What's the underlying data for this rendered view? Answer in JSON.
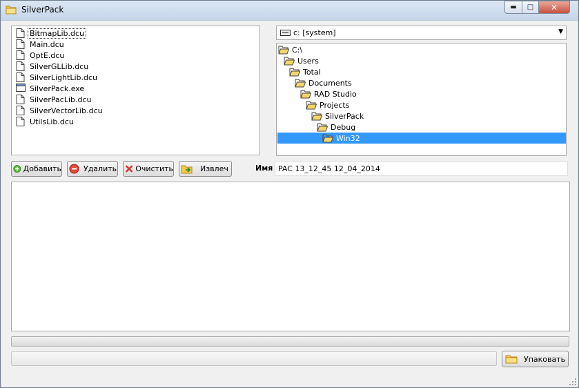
{
  "window": {
    "title": "SilverPack"
  },
  "files": [
    {
      "name": "BitmapLib.dcu",
      "icon": "document-icon",
      "selected": true
    },
    {
      "name": "Main.dcu",
      "icon": "document-icon"
    },
    {
      "name": "OptE.dcu",
      "icon": "document-icon"
    },
    {
      "name": "SilverGLLib.dcu",
      "icon": "document-icon"
    },
    {
      "name": "SilverLightLib.dcu",
      "icon": "document-icon"
    },
    {
      "name": "SilverPack.exe",
      "icon": "application-icon"
    },
    {
      "name": "SilverPacLib.dcu",
      "icon": "document-icon"
    },
    {
      "name": "SilverVectorLib.dcu",
      "icon": "document-icon"
    },
    {
      "name": "UtilsLib.dcu",
      "icon": "document-icon"
    }
  ],
  "drive": {
    "value": "c: [system]"
  },
  "tree": [
    {
      "label": "C:\\"
    },
    {
      "label": "Users"
    },
    {
      "label": "Total"
    },
    {
      "label": "Documents"
    },
    {
      "label": "RAD Studio"
    },
    {
      "label": "Projects"
    },
    {
      "label": "SilverPack"
    },
    {
      "label": "Debug"
    },
    {
      "label": "Win32",
      "selected": true
    }
  ],
  "buttons": {
    "add": "Добавить",
    "remove": "Удалить",
    "clear": "Очистить",
    "extract": "Извлеч"
  },
  "name": {
    "label": "Имя",
    "value": "PAC 13_12_45 12_04_2014"
  },
  "pack": {
    "label": "Упаковать"
  },
  "progress": {
    "value": 0
  },
  "colors": {
    "selection": "#3399ff",
    "folder": "#f5d56a"
  }
}
